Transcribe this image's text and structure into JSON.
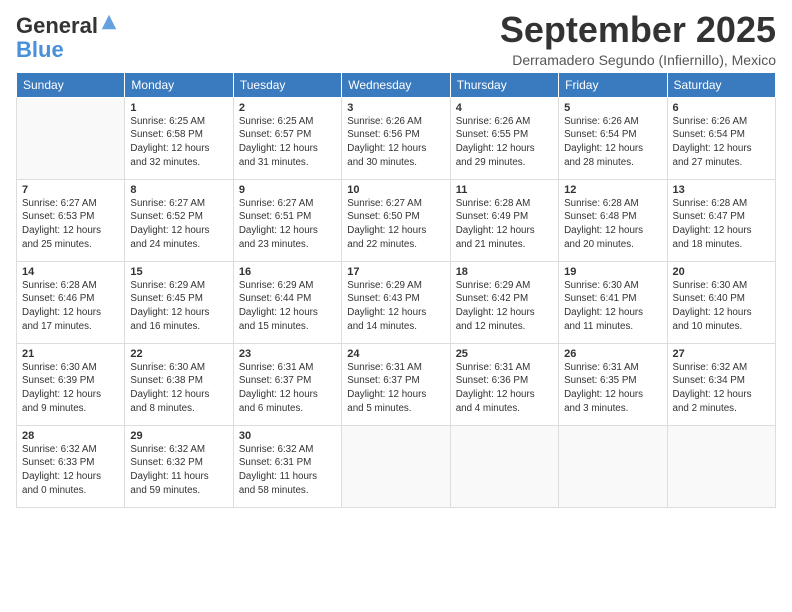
{
  "logo": {
    "line1": "General",
    "line2": "Blue"
  },
  "title": "September 2025",
  "location": "Derramadero Segundo (Infiernillo), Mexico",
  "days_of_week": [
    "Sunday",
    "Monday",
    "Tuesday",
    "Wednesday",
    "Thursday",
    "Friday",
    "Saturday"
  ],
  "weeks": [
    [
      {
        "day": "",
        "info": ""
      },
      {
        "day": "1",
        "info": "Sunrise: 6:25 AM\nSunset: 6:58 PM\nDaylight: 12 hours\nand 32 minutes."
      },
      {
        "day": "2",
        "info": "Sunrise: 6:25 AM\nSunset: 6:57 PM\nDaylight: 12 hours\nand 31 minutes."
      },
      {
        "day": "3",
        "info": "Sunrise: 6:26 AM\nSunset: 6:56 PM\nDaylight: 12 hours\nand 30 minutes."
      },
      {
        "day": "4",
        "info": "Sunrise: 6:26 AM\nSunset: 6:55 PM\nDaylight: 12 hours\nand 29 minutes."
      },
      {
        "day": "5",
        "info": "Sunrise: 6:26 AM\nSunset: 6:54 PM\nDaylight: 12 hours\nand 28 minutes."
      },
      {
        "day": "6",
        "info": "Sunrise: 6:26 AM\nSunset: 6:54 PM\nDaylight: 12 hours\nand 27 minutes."
      }
    ],
    [
      {
        "day": "7",
        "info": "Sunrise: 6:27 AM\nSunset: 6:53 PM\nDaylight: 12 hours\nand 25 minutes."
      },
      {
        "day": "8",
        "info": "Sunrise: 6:27 AM\nSunset: 6:52 PM\nDaylight: 12 hours\nand 24 minutes."
      },
      {
        "day": "9",
        "info": "Sunrise: 6:27 AM\nSunset: 6:51 PM\nDaylight: 12 hours\nand 23 minutes."
      },
      {
        "day": "10",
        "info": "Sunrise: 6:27 AM\nSunset: 6:50 PM\nDaylight: 12 hours\nand 22 minutes."
      },
      {
        "day": "11",
        "info": "Sunrise: 6:28 AM\nSunset: 6:49 PM\nDaylight: 12 hours\nand 21 minutes."
      },
      {
        "day": "12",
        "info": "Sunrise: 6:28 AM\nSunset: 6:48 PM\nDaylight: 12 hours\nand 20 minutes."
      },
      {
        "day": "13",
        "info": "Sunrise: 6:28 AM\nSunset: 6:47 PM\nDaylight: 12 hours\nand 18 minutes."
      }
    ],
    [
      {
        "day": "14",
        "info": "Sunrise: 6:28 AM\nSunset: 6:46 PM\nDaylight: 12 hours\nand 17 minutes."
      },
      {
        "day": "15",
        "info": "Sunrise: 6:29 AM\nSunset: 6:45 PM\nDaylight: 12 hours\nand 16 minutes."
      },
      {
        "day": "16",
        "info": "Sunrise: 6:29 AM\nSunset: 6:44 PM\nDaylight: 12 hours\nand 15 minutes."
      },
      {
        "day": "17",
        "info": "Sunrise: 6:29 AM\nSunset: 6:43 PM\nDaylight: 12 hours\nand 14 minutes."
      },
      {
        "day": "18",
        "info": "Sunrise: 6:29 AM\nSunset: 6:42 PM\nDaylight: 12 hours\nand 12 minutes."
      },
      {
        "day": "19",
        "info": "Sunrise: 6:30 AM\nSunset: 6:41 PM\nDaylight: 12 hours\nand 11 minutes."
      },
      {
        "day": "20",
        "info": "Sunrise: 6:30 AM\nSunset: 6:40 PM\nDaylight: 12 hours\nand 10 minutes."
      }
    ],
    [
      {
        "day": "21",
        "info": "Sunrise: 6:30 AM\nSunset: 6:39 PM\nDaylight: 12 hours\nand 9 minutes."
      },
      {
        "day": "22",
        "info": "Sunrise: 6:30 AM\nSunset: 6:38 PM\nDaylight: 12 hours\nand 8 minutes."
      },
      {
        "day": "23",
        "info": "Sunrise: 6:31 AM\nSunset: 6:37 PM\nDaylight: 12 hours\nand 6 minutes."
      },
      {
        "day": "24",
        "info": "Sunrise: 6:31 AM\nSunset: 6:37 PM\nDaylight: 12 hours\nand 5 minutes."
      },
      {
        "day": "25",
        "info": "Sunrise: 6:31 AM\nSunset: 6:36 PM\nDaylight: 12 hours\nand 4 minutes."
      },
      {
        "day": "26",
        "info": "Sunrise: 6:31 AM\nSunset: 6:35 PM\nDaylight: 12 hours\nand 3 minutes."
      },
      {
        "day": "27",
        "info": "Sunrise: 6:32 AM\nSunset: 6:34 PM\nDaylight: 12 hours\nand 2 minutes."
      }
    ],
    [
      {
        "day": "28",
        "info": "Sunrise: 6:32 AM\nSunset: 6:33 PM\nDaylight: 12 hours\nand 0 minutes."
      },
      {
        "day": "29",
        "info": "Sunrise: 6:32 AM\nSunset: 6:32 PM\nDaylight: 11 hours\nand 59 minutes."
      },
      {
        "day": "30",
        "info": "Sunrise: 6:32 AM\nSunset: 6:31 PM\nDaylight: 11 hours\nand 58 minutes."
      },
      {
        "day": "",
        "info": ""
      },
      {
        "day": "",
        "info": ""
      },
      {
        "day": "",
        "info": ""
      },
      {
        "day": "",
        "info": ""
      }
    ]
  ]
}
